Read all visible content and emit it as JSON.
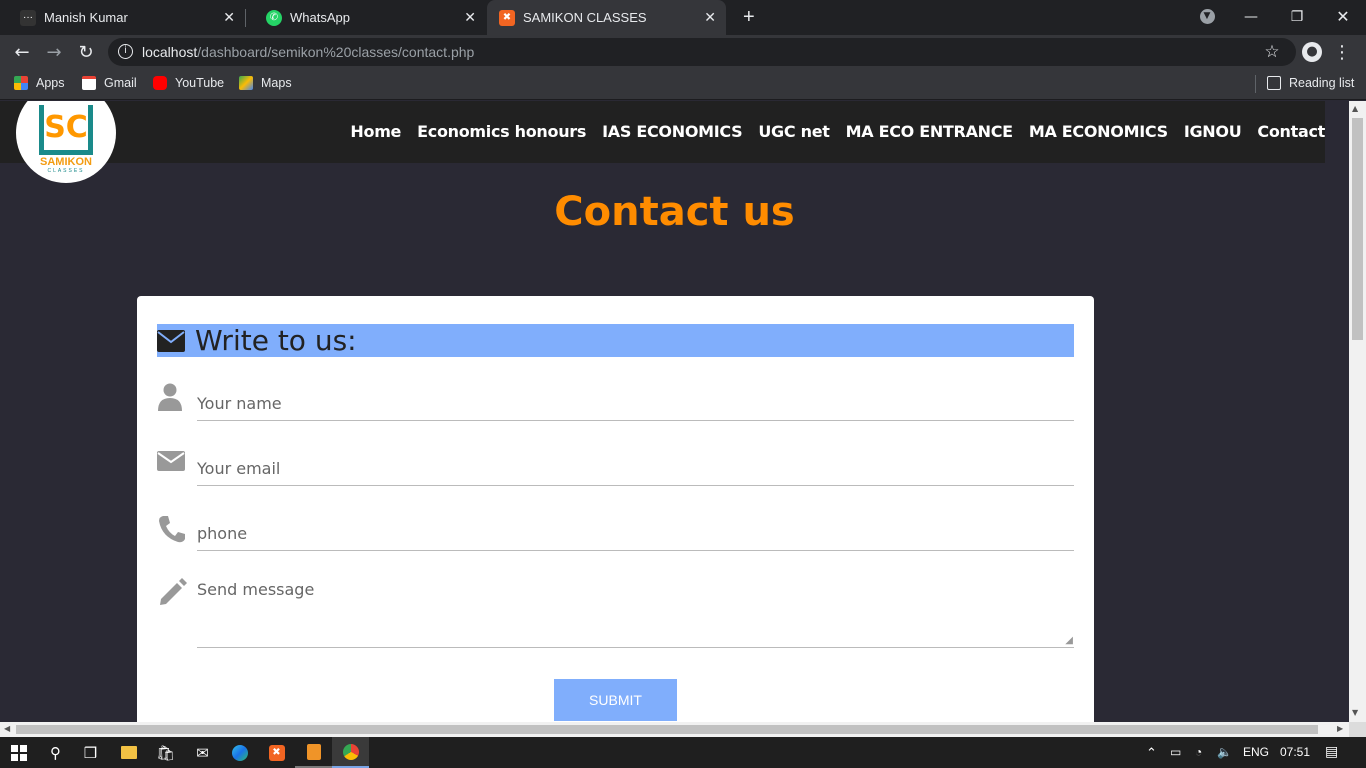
{
  "browser": {
    "tabs": [
      {
        "title": "Manish Kumar"
      },
      {
        "title": "WhatsApp"
      },
      {
        "title": "SAMIKON CLASSES"
      }
    ],
    "url_host": "localhost",
    "url_path": "/dashboard/semikon%20classes/contact.php",
    "bookmarks": [
      "Apps",
      "Gmail",
      "YouTube",
      "Maps"
    ],
    "reading_list": "Reading list"
  },
  "site": {
    "logo_text": "SAMIKON",
    "logo_sub": "CLASSES",
    "logo_mark": "SC",
    "nav": [
      "Home",
      "Economics honours",
      "IAS ECONOMICS",
      "UGC net",
      "MA ECO ENTRANCE",
      "MA ECONOMICS",
      "IGNOU",
      "Contact"
    ],
    "heading": "Contact us",
    "form": {
      "title": "Write to us:",
      "name_placeholder": "Your name",
      "email_placeholder": "Your email",
      "phone_placeholder": "phone",
      "message_placeholder": "Send message",
      "submit": "SUBMIT"
    }
  },
  "taskbar": {
    "lang": "ENG",
    "time": "07:51"
  },
  "colors": {
    "accent_orange": "#ff8c00",
    "form_bar": "#80aefc",
    "page_bg": "#2a2934"
  }
}
